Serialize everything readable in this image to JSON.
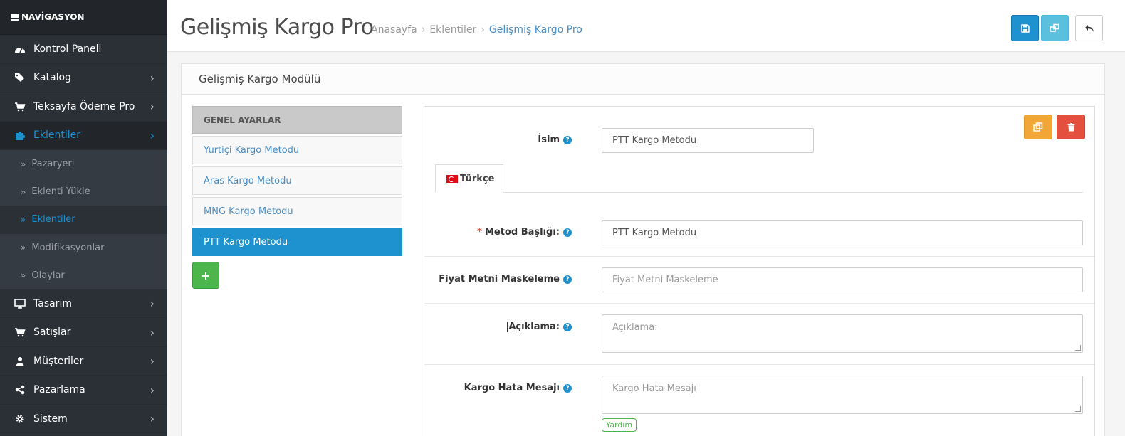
{
  "sidebar": {
    "header": "NAVİGASYON",
    "items": [
      {
        "label": "Kontrol Paneli",
        "icon": "dashboard-icon",
        "has_children": false
      },
      {
        "label": "Katalog",
        "icon": "tags-icon",
        "has_children": true
      },
      {
        "label": "Teksayfa Ödeme Pro",
        "icon": "cart-icon",
        "has_children": true
      },
      {
        "label": "Eklentiler",
        "icon": "puzzle-icon",
        "has_children": true,
        "active": true
      }
    ],
    "submenu": [
      {
        "label": "Pazaryeri"
      },
      {
        "label": "Eklenti Yükle"
      },
      {
        "label": "Eklentiler",
        "active": true
      },
      {
        "label": "Modifikasyonlar"
      },
      {
        "label": "Olaylar"
      }
    ],
    "items_after": [
      {
        "label": "Tasarım",
        "icon": "monitor-icon"
      },
      {
        "label": "Satışlar",
        "icon": "cart-icon"
      },
      {
        "label": "Müşteriler",
        "icon": "user-icon"
      },
      {
        "label": "Pazarlama",
        "icon": "share-icon"
      },
      {
        "label": "Sistem",
        "icon": "gear-icon"
      }
    ]
  },
  "header": {
    "title": "Gelişmiş Kargo Pro",
    "breadcrumb": [
      "Anasayfa",
      "Eklentiler",
      "Gelişmiş Kargo Pro"
    ]
  },
  "panel": {
    "title": "Gelişmiş Kargo Modülü"
  },
  "methods": {
    "header": "GENEL AYARLAR",
    "items": [
      "Yurtiçi Kargo Metodu",
      "Aras Kargo Metodu",
      "MNG Kargo Metodu",
      "PTT Kargo Metodu"
    ],
    "active_index": 3
  },
  "form": {
    "name_label": "İsim",
    "name_value": "PTT Kargo Metodu",
    "tab_label": "Türkçe",
    "method_title_label": "Metod Başlığı:",
    "method_title_value": "PTT Kargo Metodu",
    "price_mask_label": "Fiyat Metni Maskeleme",
    "price_mask_placeholder": "Fiyat Metni Maskeleme",
    "description_label": "Açıklama:",
    "description_placeholder": "Açıklama:",
    "error_msg_label": "Kargo Hata Mesajı",
    "error_msg_placeholder": "Kargo Hata Mesajı",
    "help_badge": "Yardım",
    "required_mark": "*",
    "help_glyph": "?"
  },
  "colors": {
    "accent": "#1e91cf",
    "sidebar_bg": "#2b3036",
    "success": "#4cb64c",
    "warning": "#f3a638",
    "danger": "#e3503e"
  }
}
